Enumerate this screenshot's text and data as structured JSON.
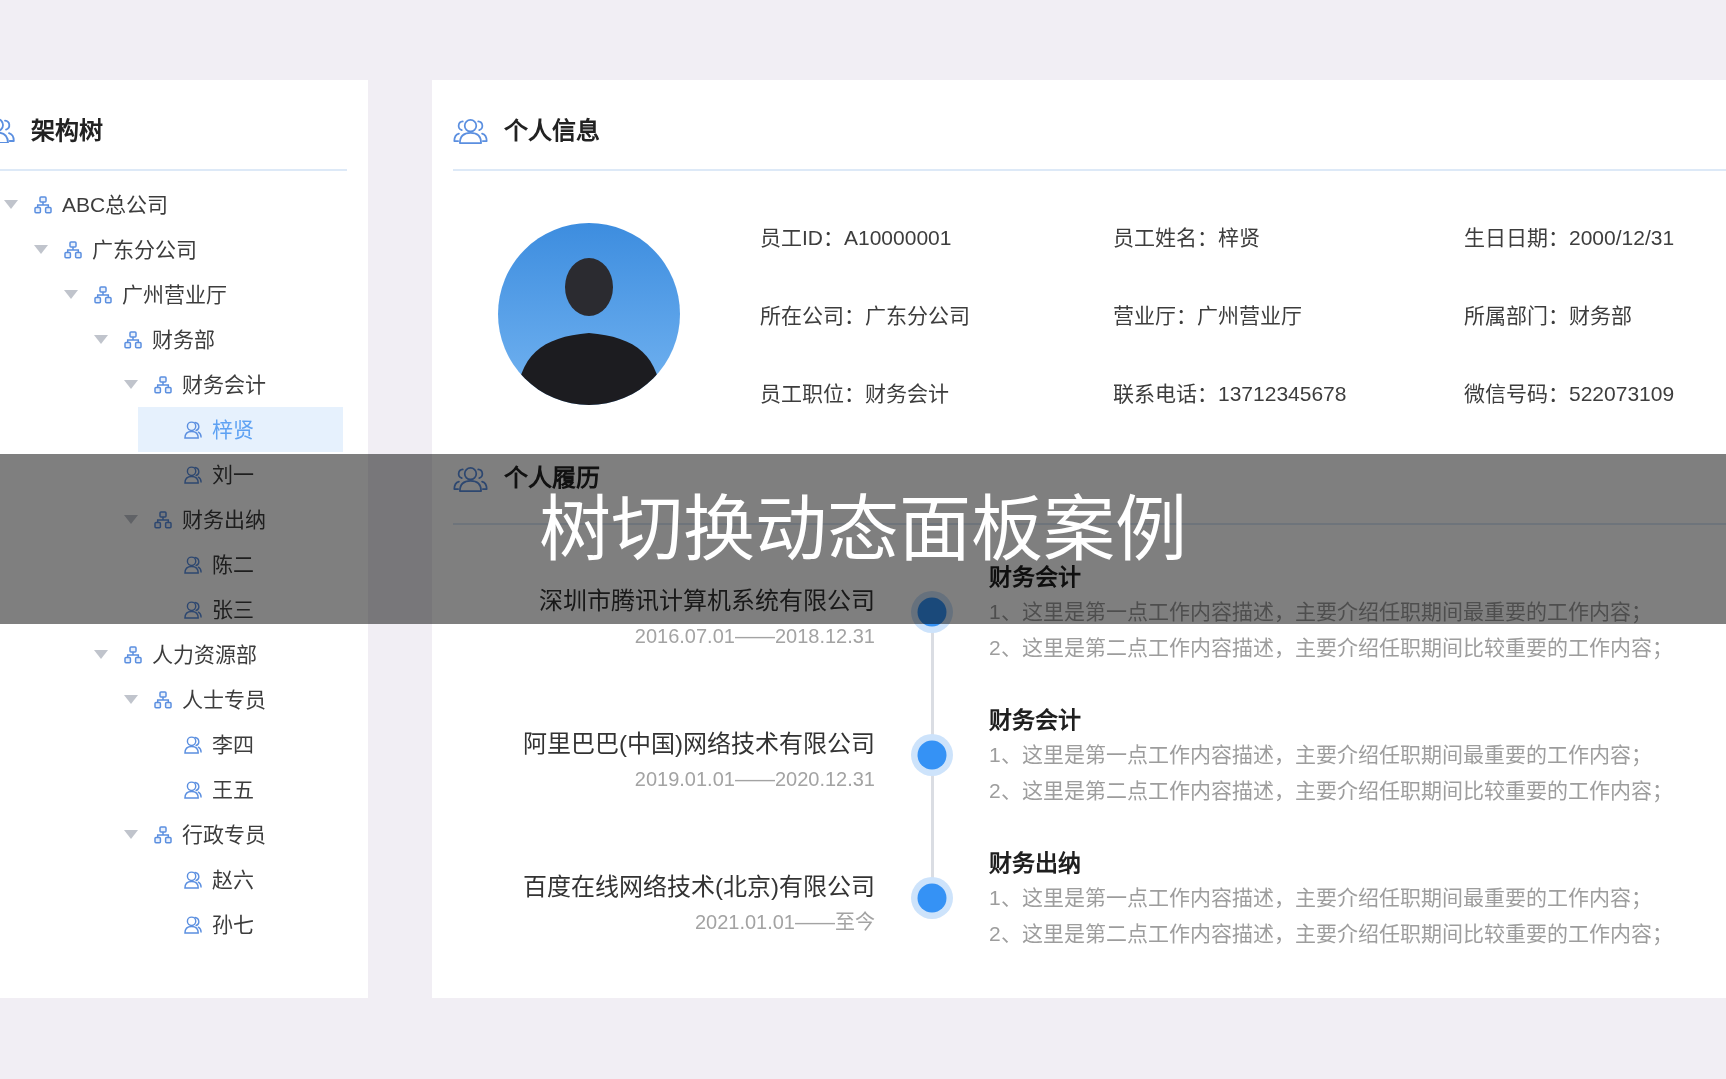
{
  "tree_panel": {
    "title": "架构树",
    "tree": [
      {
        "label": "ABC总公司",
        "kind": "org",
        "expanded": true,
        "selected": false,
        "children": [
          {
            "label": "广东分公司",
            "kind": "org",
            "expanded": true,
            "selected": false,
            "children": [
              {
                "label": "广州营业厅",
                "kind": "org",
                "expanded": true,
                "selected": false,
                "children": [
                  {
                    "label": "财务部",
                    "kind": "org",
                    "expanded": true,
                    "selected": false,
                    "children": [
                      {
                        "label": "财务会计",
                        "kind": "org",
                        "expanded": true,
                        "selected": false,
                        "children": [
                          {
                            "label": "梓贤",
                            "kind": "person",
                            "selected": true
                          },
                          {
                            "label": "刘一",
                            "kind": "person",
                            "selected": false
                          }
                        ]
                      },
                      {
                        "label": "财务出纳",
                        "kind": "org",
                        "expanded": true,
                        "selected": false,
                        "children": [
                          {
                            "label": "陈二",
                            "kind": "person",
                            "selected": false
                          },
                          {
                            "label": "张三",
                            "kind": "person",
                            "selected": false
                          }
                        ]
                      }
                    ]
                  },
                  {
                    "label": "人力资源部",
                    "kind": "org",
                    "expanded": true,
                    "selected": false,
                    "children": [
                      {
                        "label": "人士专员",
                        "kind": "org",
                        "expanded": true,
                        "selected": false,
                        "children": [
                          {
                            "label": "李四",
                            "kind": "person",
                            "selected": false
                          },
                          {
                            "label": "王五",
                            "kind": "person",
                            "selected": false
                          }
                        ]
                      },
                      {
                        "label": "行政专员",
                        "kind": "org",
                        "expanded": true,
                        "selected": false,
                        "children": [
                          {
                            "label": "赵六",
                            "kind": "person",
                            "selected": false
                          },
                          {
                            "label": "孙七",
                            "kind": "person",
                            "selected": false
                          }
                        ]
                      }
                    ]
                  }
                ]
              }
            ]
          }
        ]
      }
    ]
  },
  "profile_panel": {
    "title": "个人信息",
    "fields": [
      {
        "label": "员工ID：",
        "value": "A10000001"
      },
      {
        "label": "员工姓名：",
        "value": "梓贤"
      },
      {
        "label": "生日日期：",
        "value": "2000/12/31"
      },
      {
        "label": "所在公司：",
        "value": "广东分公司"
      },
      {
        "label": "营业厅：",
        "value": "广州营业厅"
      },
      {
        "label": "所属部门：",
        "value": "财务部"
      },
      {
        "label": "员工职位：",
        "value": "财务会计"
      },
      {
        "label": "联系电话：",
        "value": "13712345678"
      },
      {
        "label": "微信号码：",
        "value": "522073109"
      }
    ]
  },
  "resume_panel": {
    "title": "个人履历",
    "entries": [
      {
        "company": "深圳市腾讯计算机系统有限公司",
        "period": "2016.07.01——2018.12.31",
        "position": "财务会计",
        "duties": [
          "1、这里是第一点工作内容描述，主要介绍任职期间最重要的工作内容；",
          "2、这里是第二点工作内容描述，主要介绍任职期间比较重要的工作内容；"
        ]
      },
      {
        "company": "阿里巴巴(中国)网络技术有限公司",
        "period": "2019.01.01——2020.12.31",
        "position": "财务会计",
        "duties": [
          "1、这里是第一点工作内容描述，主要介绍任职期间最重要的工作内容；",
          "2、这里是第二点工作内容描述，主要介绍任职期间比较重要的工作内容；"
        ]
      },
      {
        "company": "百度在线网络技术(北京)有限公司",
        "period": "2021.01.01——至今",
        "position": "财务出纳",
        "duties": [
          "1、这里是第一点工作内容描述，主要介绍任职期间最重要的工作内容；",
          "2、这里是第二点工作内容描述，主要介绍任职期间比较重要的工作内容；"
        ]
      }
    ]
  },
  "overlay_banner": {
    "title": "树切换动态面板案例"
  }
}
